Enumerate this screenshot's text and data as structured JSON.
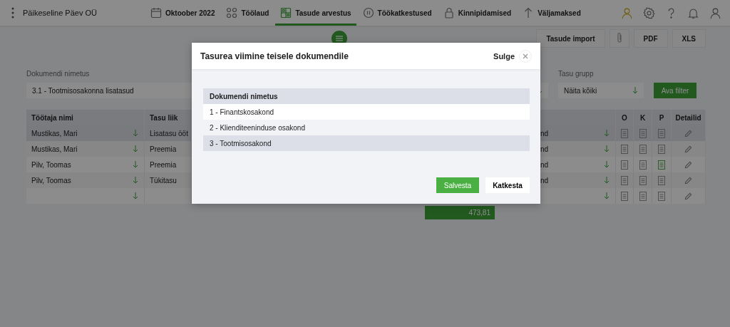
{
  "header": {
    "company": "Päikeseline Päev OÜ",
    "nav": [
      {
        "label": "Oktoober 2022",
        "kind": "calendar",
        "selected": false
      },
      {
        "label": "Töölaud",
        "kind": "circles",
        "selected": false
      },
      {
        "label": "Tasude arvestus",
        "kind": "grid",
        "selected": true
      },
      {
        "label": "Töökatkestused",
        "kind": "pause",
        "selected": false
      },
      {
        "label": "Kinnipidamised",
        "kind": "lock",
        "selected": false
      },
      {
        "label": "Väljamaksed",
        "kind": "arrow",
        "selected": false
      }
    ]
  },
  "toolbar": {
    "buttons": [
      {
        "kind": "text",
        "label": "Tasude import"
      },
      {
        "kind": "clip"
      },
      {
        "kind": "text",
        "label": "PDF"
      },
      {
        "kind": "text",
        "label": "XLS"
      }
    ]
  },
  "filters": {
    "document": {
      "label": "Dokumendi nimetus",
      "value": "3.1 - Tootmisosakonna lisatasud"
    },
    "group": {
      "label": "Tasu grupp",
      "value": "Näita kõiki"
    },
    "apply_button": "Ava filter"
  },
  "table": {
    "columns": [
      "Töötaja nimi",
      "Tasu liik",
      "O",
      "K",
      "P",
      "Detailid"
    ],
    "rows": [
      {
        "name": "Mustikas, Mari",
        "pay_type": "Lisatasu ööt",
        "column_4": "nd",
        "selected": true,
        "o_active": false,
        "k_active": false,
        "p_active": false
      },
      {
        "name": "Mustikas, Mari",
        "pay_type": "Preemia",
        "column_4": "nd",
        "selected": false,
        "o_active": false,
        "k_active": false,
        "p_active": false
      },
      {
        "name": "Pilv, Toomas",
        "pay_type": "Preemia",
        "column_4": "nd",
        "selected": false,
        "o_active": false,
        "k_active": false,
        "p_active": true
      },
      {
        "name": "Pilv, Toomas",
        "pay_type": "Tükitasu",
        "column_4": "nd",
        "selected": false,
        "o_active": false,
        "k_active": false,
        "p_active": false
      },
      {
        "selected": false,
        "o_active": false,
        "k_active": false,
        "p_active": false
      }
    ],
    "total": "473,81"
  },
  "modal": {
    "title": "Tasurea viimine teisele dokumendile",
    "close_label": "Sulge",
    "list_header": "Dokumendi nimetus",
    "items": [
      {
        "label": "1 - Finantskosakond",
        "selected": false
      },
      {
        "label": "2 - Klienditeeninduse osakond",
        "selected": false
      },
      {
        "label": "3 - Tootmisosakond",
        "selected": true
      }
    ],
    "save_button": "Salvesta",
    "cancel_button": "Katkesta"
  }
}
